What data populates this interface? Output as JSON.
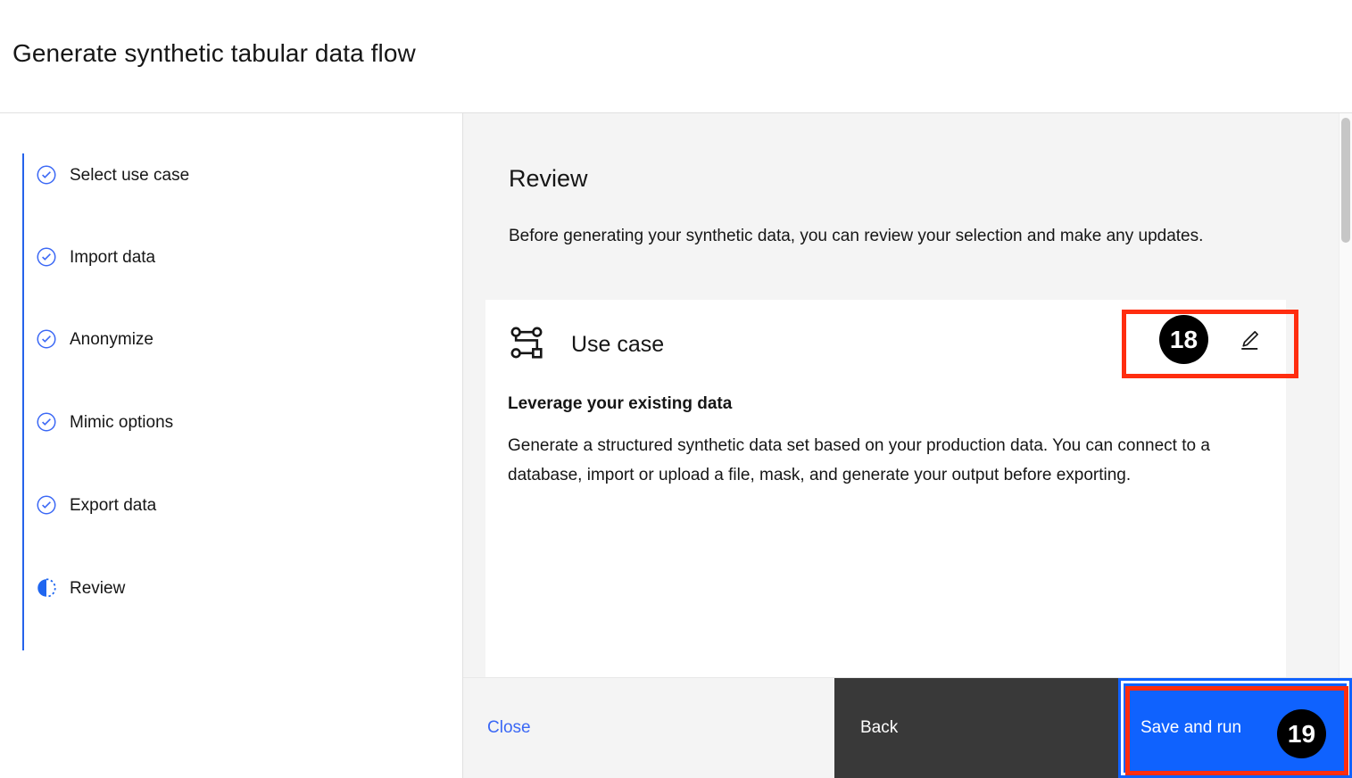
{
  "header": {
    "title": "Generate synthetic tabular data flow"
  },
  "sidebar": {
    "steps": [
      {
        "label": "Select use case",
        "icon": "checkmark-circle-icon",
        "state": "complete"
      },
      {
        "label": "Import data",
        "icon": "checkmark-circle-icon",
        "state": "complete"
      },
      {
        "label": "Anonymize",
        "icon": "checkmark-circle-icon",
        "state": "complete"
      },
      {
        "label": "Mimic options",
        "icon": "checkmark-circle-icon",
        "state": "complete"
      },
      {
        "label": "Export data",
        "icon": "checkmark-circle-icon",
        "state": "complete"
      },
      {
        "label": "Review",
        "icon": "in-progress-half-circle-icon",
        "state": "current"
      }
    ]
  },
  "main": {
    "section_title": "Review",
    "section_description": "Before generating your synthetic data, you can review your selection and make any updates.",
    "card": {
      "icon": "flow-data-icon",
      "title": "Use case",
      "subtitle": "Leverage your existing data",
      "body": "Generate a structured synthetic data set based on your production data. You can connect to a database, import or upload a file, mask, and generate your output before exporting.",
      "edit_icon": "edit-pencil-icon"
    }
  },
  "footer": {
    "close_label": "Close",
    "back_label": "Back",
    "save_and_run_label": "Save and run"
  },
  "annotations": [
    {
      "number": "18",
      "target": "edit-use-case-button"
    },
    {
      "number": "19",
      "target": "save-and-run-button"
    }
  ],
  "colors": {
    "accent_blue": "#0f62fe",
    "step_blue": "#2563eb",
    "link_blue": "#3b68f5",
    "dark_button": "#393939",
    "panel_bg": "#f4f4f4",
    "annotation_red": "#ff2d0f",
    "badge_black": "#000000"
  }
}
